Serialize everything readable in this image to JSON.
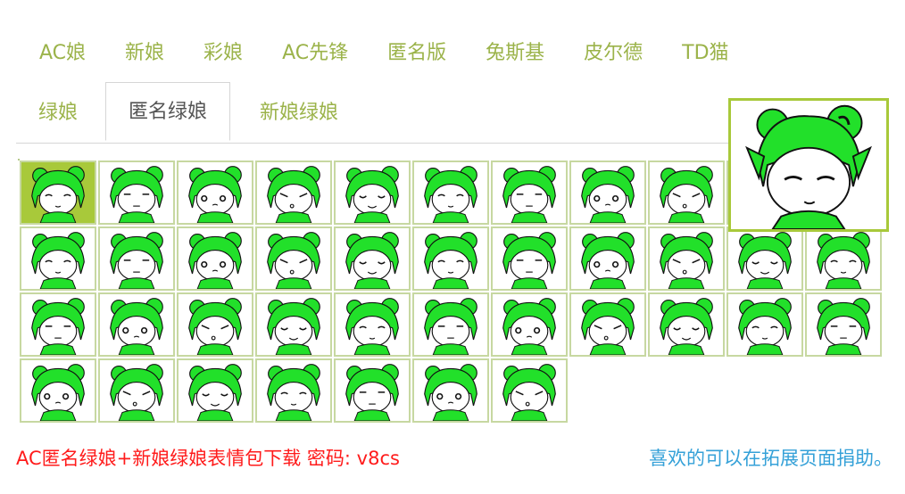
{
  "tabs_row1": [
    "AC娘",
    "新娘",
    "彩娘",
    "AC先锋",
    "匿名版",
    "兔斯基",
    "皮尔德",
    "TD猫"
  ],
  "tabs_row2": [
    "绿娘",
    "匿名绿娘",
    "新娘绿娘"
  ],
  "active_tab": "匿名绿娘",
  "emoticon_grid": {
    "rows": [
      10,
      11,
      11,
      7
    ],
    "selected_index": 0,
    "item_name": "sticker-icon"
  },
  "footer": {
    "download_text": "AC匿名绿娘+新娘绿娘表情包下载 密码: v8cs",
    "support_text": "喜欢的可以在拓展页面捐助。"
  },
  "colors": {
    "tab_text": "#9bb34a",
    "active_tab_text": "#555555",
    "hair_green": "#22e02a",
    "selected_bg": "#a8c93a",
    "download_text": "#ff1b1b",
    "support_text": "#35a1d8"
  }
}
